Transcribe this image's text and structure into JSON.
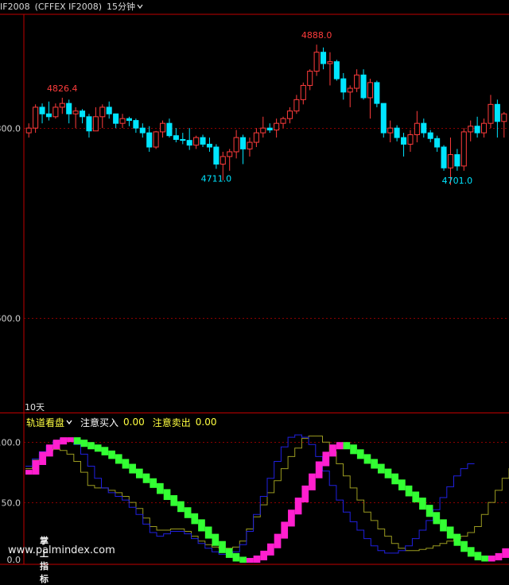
{
  "header": {
    "symbol": "IF2008",
    "exchange": "(CFFEX IF2008)",
    "period": "15分钟"
  },
  "main_chart": {
    "y_ticks": [
      "800.0",
      "600.0"
    ],
    "annotations": {
      "high_left": "4826.4",
      "high_peak": "4888.0",
      "low_mid": "4711.0",
      "low_right": "4701.0"
    },
    "period_label": "10天",
    "colors": {
      "up": "#ff3c3c",
      "down": "#00e5ff",
      "grid": "#8b0000",
      "axis": "#c00000"
    }
  },
  "indicator": {
    "name": "轨道看盘",
    "buy_label": "注意买入",
    "buy_value": "0.00",
    "sell_label": "注意卖出",
    "sell_value": "0.00",
    "y_ticks": [
      "100.0",
      "50.0",
      "0.0"
    ],
    "colors": {
      "magenta": "#ff1fce",
      "green": "#33ff33",
      "blue": "#2020e0",
      "olive": "#9a9a20"
    }
  },
  "watermark": {
    "cn": "掌上指标",
    "url": "www.palmindex.com"
  },
  "chart_data": [
    {
      "type": "candlestick",
      "title": "",
      "y_range": [
        4500,
        4920
      ],
      "candles": [
        [
          4795,
          4805,
          4790,
          4800
        ],
        [
          4800,
          4825,
          4795,
          4822
        ],
        [
          4822,
          4826,
          4805,
          4815
        ],
        [
          4815,
          4828,
          4808,
          4812
        ],
        [
          4812,
          4826,
          4810,
          4822
        ],
        [
          4822,
          4832,
          4815,
          4826
        ],
        [
          4826,
          4830,
          4805,
          4815
        ],
        [
          4815,
          4822,
          4800,
          4818
        ],
        [
          4818,
          4820,
          4805,
          4812
        ],
        [
          4812,
          4815,
          4790,
          4797
        ],
        [
          4797,
          4822,
          4797,
          4812
        ],
        [
          4812,
          4825,
          4800,
          4822
        ],
        [
          4822,
          4828,
          4810,
          4815
        ],
        [
          4815,
          4815,
          4800,
          4805
        ],
        [
          4805,
          4815,
          4800,
          4810
        ],
        [
          4810,
          4812,
          4802,
          4808
        ],
        [
          4808,
          4810,
          4795,
          4800
        ],
        [
          4800,
          4805,
          4790,
          4795
        ],
        [
          4795,
          4802,
          4775,
          4780
        ],
        [
          4780,
          4797,
          4778,
          4796
        ],
        [
          4796,
          4808,
          4790,
          4805
        ],
        [
          4805,
          4810,
          4790,
          4792
        ],
        [
          4792,
          4800,
          4785,
          4788
        ],
        [
          4788,
          4795,
          4783,
          4787
        ],
        [
          4787,
          4800,
          4777,
          4782
        ],
        [
          4782,
          4792,
          4778,
          4790
        ],
        [
          4790,
          4793,
          4780,
          4783
        ],
        [
          4783,
          4790,
          4775,
          4780
        ],
        [
          4780,
          4783,
          4757,
          4762
        ],
        [
          4762,
          4775,
          4745,
          4770
        ],
        [
          4770,
          4778,
          4755,
          4775
        ],
        [
          4775,
          4798,
          4768,
          4790
        ],
        [
          4790,
          4793,
          4762,
          4778
        ],
        [
          4778,
          4790,
          4770,
          4785
        ],
        [
          4785,
          4800,
          4780,
          4795
        ],
        [
          4795,
          4812,
          4790,
          4800
        ],
        [
          4800,
          4805,
          4795,
          4798
        ],
        [
          4798,
          4810,
          4790,
          4805
        ],
        [
          4805,
          4812,
          4800,
          4810
        ],
        [
          4810,
          4822,
          4805,
          4818
        ],
        [
          4818,
          4835,
          4815,
          4830
        ],
        [
          4830,
          4848,
          4825,
          4845
        ],
        [
          4845,
          4862,
          4840,
          4860
        ],
        [
          4860,
          4888,
          4855,
          4880
        ],
        [
          4880,
          4885,
          4862,
          4868
        ],
        [
          4868,
          4880,
          4845,
          4870
        ],
        [
          4870,
          4872,
          4850,
          4852
        ],
        [
          4852,
          4858,
          4830,
          4838
        ],
        [
          4838,
          4845,
          4822,
          4842
        ],
        [
          4842,
          4862,
          4838,
          4856
        ],
        [
          4856,
          4862,
          4830,
          4832
        ],
        [
          4832,
          4852,
          4810,
          4848
        ],
        [
          4848,
          4850,
          4822,
          4826
        ],
        [
          4826,
          4826,
          4790,
          4795
        ],
        [
          4795,
          4808,
          4785,
          4800
        ],
        [
          4800,
          4803,
          4786,
          4790
        ],
        [
          4790,
          4795,
          4770,
          4783
        ],
        [
          4783,
          4798,
          4775,
          4793
        ],
        [
          4793,
          4818,
          4785,
          4805
        ],
        [
          4805,
          4810,
          4790,
          4795
        ],
        [
          4795,
          4798,
          4785,
          4789
        ],
        [
          4789,
          4792,
          4775,
          4780
        ],
        [
          4780,
          4782,
          4755,
          4758
        ],
        [
          4758,
          4790,
          4740,
          4772
        ],
        [
          4772,
          4778,
          4755,
          4760
        ],
        [
          4760,
          4800,
          4755,
          4796
        ],
        [
          4796,
          4808,
          4786,
          4802
        ],
        [
          4802,
          4812,
          4790,
          4795
        ],
        [
          4795,
          4810,
          4790,
          4805
        ],
        [
          4805,
          4835,
          4800,
          4825
        ],
        [
          4825,
          4830,
          4790,
          4807
        ],
        [
          4807,
          4817,
          4790,
          4815
        ]
      ]
    },
    {
      "type": "line",
      "title": "",
      "y_range": [
        0,
        110
      ],
      "series": [
        {
          "values": [
            75,
            83,
            90,
            96,
            100,
            102,
            102,
            100,
            98,
            96,
            94,
            91,
            88,
            84,
            80,
            76,
            72,
            68,
            64,
            59,
            54,
            49,
            44,
            39,
            34,
            28,
            22,
            16,
            10,
            6,
            3,
            2,
            2,
            4,
            8,
            14,
            22,
            32,
            42,
            52,
            62,
            72,
            82,
            90,
            96,
            98,
            96,
            92,
            88,
            84,
            80,
            76,
            72,
            67,
            62,
            57,
            52,
            46,
            40,
            34,
            28,
            22,
            16,
            11,
            7,
            4,
            3,
            4,
            6,
            10
          ]
        },
        {
          "values": [
            77,
            84,
            91,
            96,
            100,
            102,
            102,
            100,
            98,
            96,
            94,
            91,
            88,
            84,
            80,
            76,
            72,
            68,
            64,
            59,
            54,
            49,
            44,
            39,
            34,
            28,
            22,
            16,
            10,
            6,
            3,
            2,
            2,
            4,
            8,
            14,
            22,
            32,
            42,
            52,
            62,
            72,
            82,
            90,
            96,
            98,
            96,
            92,
            88,
            84,
            80,
            76,
            72,
            67,
            62,
            57,
            52,
            46,
            40,
            34,
            28,
            22,
            16,
            11,
            7,
            4,
            3,
            4,
            6,
            10
          ]
        },
        {
          "values": [
            78,
            85,
            90,
            93,
            94,
            93,
            90,
            84,
            75,
            64,
            62,
            62,
            60,
            58,
            55,
            50,
            45,
            37,
            30,
            27,
            27,
            28,
            28,
            26,
            22,
            18,
            15,
            13,
            12,
            12,
            13,
            18,
            28,
            38,
            48,
            58,
            68,
            78,
            88,
            95,
            103,
            105,
            105,
            100,
            92,
            82,
            72,
            62,
            52,
            42,
            35,
            28,
            22,
            16,
            12,
            10,
            10,
            11,
            12,
            14,
            16,
            18,
            20,
            22,
            25,
            30,
            40,
            50,
            60,
            70,
            78,
            82
          ]
        },
        {
          "values": [
            80,
            86,
            92,
            97,
            101,
            103,
            102,
            98,
            90,
            80,
            70,
            62,
            58,
            55,
            52,
            46,
            40,
            32,
            25,
            22,
            24,
            26,
            26,
            24,
            20,
            16,
            12,
            9,
            7,
            7,
            9,
            15,
            26,
            40,
            55,
            70,
            84,
            96,
            104,
            106,
            104,
            98,
            88,
            76,
            64,
            52,
            42,
            34,
            27,
            20,
            14,
            10,
            8,
            8,
            10,
            14,
            20,
            27,
            35,
            44,
            54,
            63,
            72,
            78,
            82
          ]
        }
      ]
    }
  ]
}
